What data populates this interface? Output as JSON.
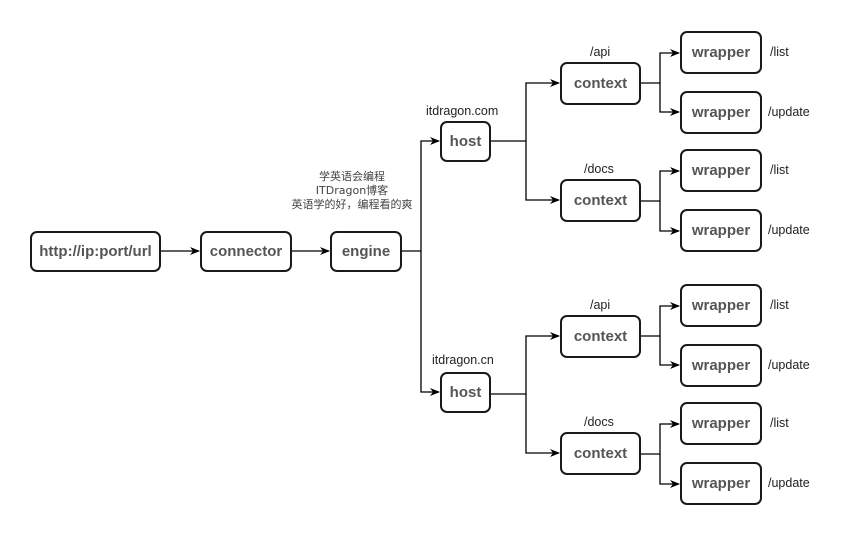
{
  "diagram": {
    "request": "http://ip:port/url",
    "connector": "connector",
    "engine": "engine",
    "note": [
      "学英语会编程",
      "ITDragon博客",
      "英语学的好，编程看的爽"
    ],
    "hosts": [
      {
        "label": "itdragon.com",
        "name": "host",
        "contexts": [
          {
            "label": "/api",
            "name": "context",
            "wrappers": [
              {
                "name": "wrapper",
                "label": "/list"
              },
              {
                "name": "wrapper",
                "label": "/update"
              }
            ]
          },
          {
            "label": "/docs",
            "name": "context",
            "wrappers": [
              {
                "name": "wrapper",
                "label": "/list"
              },
              {
                "name": "wrapper",
                "label": "/update"
              }
            ]
          }
        ]
      },
      {
        "label": "itdragon.cn",
        "name": "host",
        "contexts": [
          {
            "label": "/api",
            "name": "context",
            "wrappers": [
              {
                "name": "wrapper",
                "label": "/list"
              },
              {
                "name": "wrapper",
                "label": "/update"
              }
            ]
          },
          {
            "label": "/docs",
            "name": "context",
            "wrappers": [
              {
                "name": "wrapper",
                "label": "/list"
              },
              {
                "name": "wrapper",
                "label": "/update"
              }
            ]
          }
        ]
      }
    ]
  }
}
